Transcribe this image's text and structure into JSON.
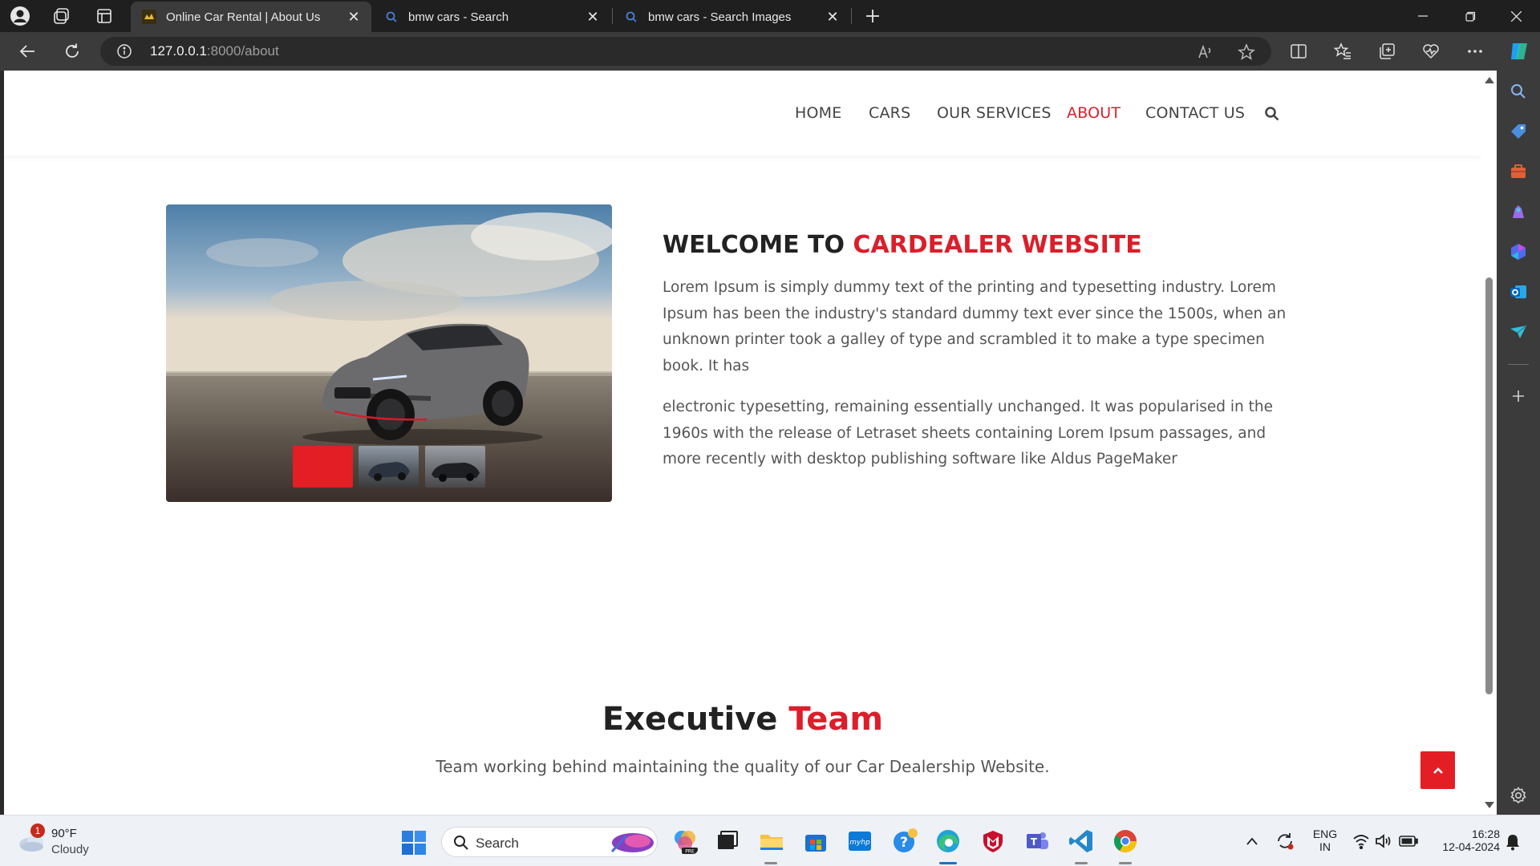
{
  "browser": {
    "tabs": [
      {
        "title": "Online Car Rental | About Us",
        "active": true
      },
      {
        "title": "bmw cars - Search",
        "active": false
      },
      {
        "title": "bmw cars - Search Images",
        "active": false
      }
    ],
    "url_host": "127.0.0.1",
    "url_path": ":8000/about"
  },
  "site": {
    "nav": [
      {
        "label": "HOME",
        "active": false
      },
      {
        "label": "CARS",
        "active": false
      },
      {
        "label": "OUR SERVICES",
        "active": false
      },
      {
        "label": "ABOUT",
        "active": true
      },
      {
        "label": "CONTACT US",
        "active": false
      }
    ],
    "welcome_prefix": "WELCOME TO ",
    "welcome_accent": "CARDEALER WEBSITE",
    "paragraph1": "Lorem Ipsum is simply dummy text of the printing and typesetting industry. Lorem Ipsum has been the industry's standard dummy text ever since the 1500s, when an unknown printer took a galley of type and scrambled it to make a type specimen book. It has",
    "paragraph2": "electronic typesetting, remaining essentially unchanged. It was popularised in the 1960s with the release of Letraset sheets containing Lorem Ipsum passages, and more recently with desktop publishing software like Aldus PageMaker",
    "team_title_prefix": "Executive ",
    "team_title_accent": "Team",
    "team_subtitle": "Team working behind maintaining the quality of our Car Dealership Website.",
    "accent_color": "#dc1e2a"
  },
  "taskbar": {
    "weather_temp": "90°F",
    "weather_desc": "Cloudy",
    "weather_badge": "1",
    "search_label": "Search",
    "lang_top": "ENG",
    "lang_bottom": "IN",
    "time": "16:28",
    "date": "12-04-2024"
  }
}
